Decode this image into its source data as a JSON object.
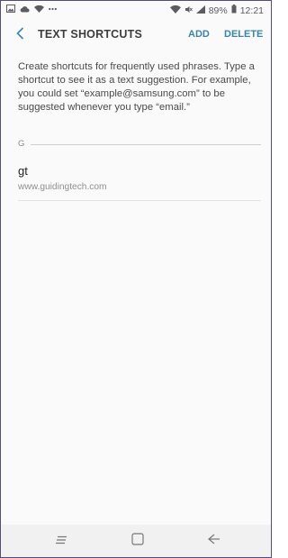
{
  "status_bar": {
    "battery_percent": "89%",
    "time": "12:21",
    "left_icons": [
      "gallery-icon",
      "cloud-icon",
      "wifi-icon",
      "more-icon"
    ],
    "right_icons": [
      "wifi-icon",
      "mute-icon",
      "signal-icon",
      "battery-icon"
    ]
  },
  "app_bar": {
    "title": "TEXT SHORTCUTS",
    "add_label": "ADD",
    "delete_label": "DELETE",
    "accent_color": "#3b84a9"
  },
  "description": "Create shortcuts for frequently used phrases. Type a shortcut to see it as a text suggestion. For example, you could set “example@samsung.com” to be suggested whenever you type “email.”",
  "sections": [
    {
      "letter": "G",
      "items": [
        {
          "shortcut": "gt",
          "phrase": "www.guidingtech.com"
        }
      ]
    }
  ],
  "nav_bar": {
    "buttons": [
      "recent-apps-icon",
      "home-icon",
      "back-icon"
    ]
  }
}
